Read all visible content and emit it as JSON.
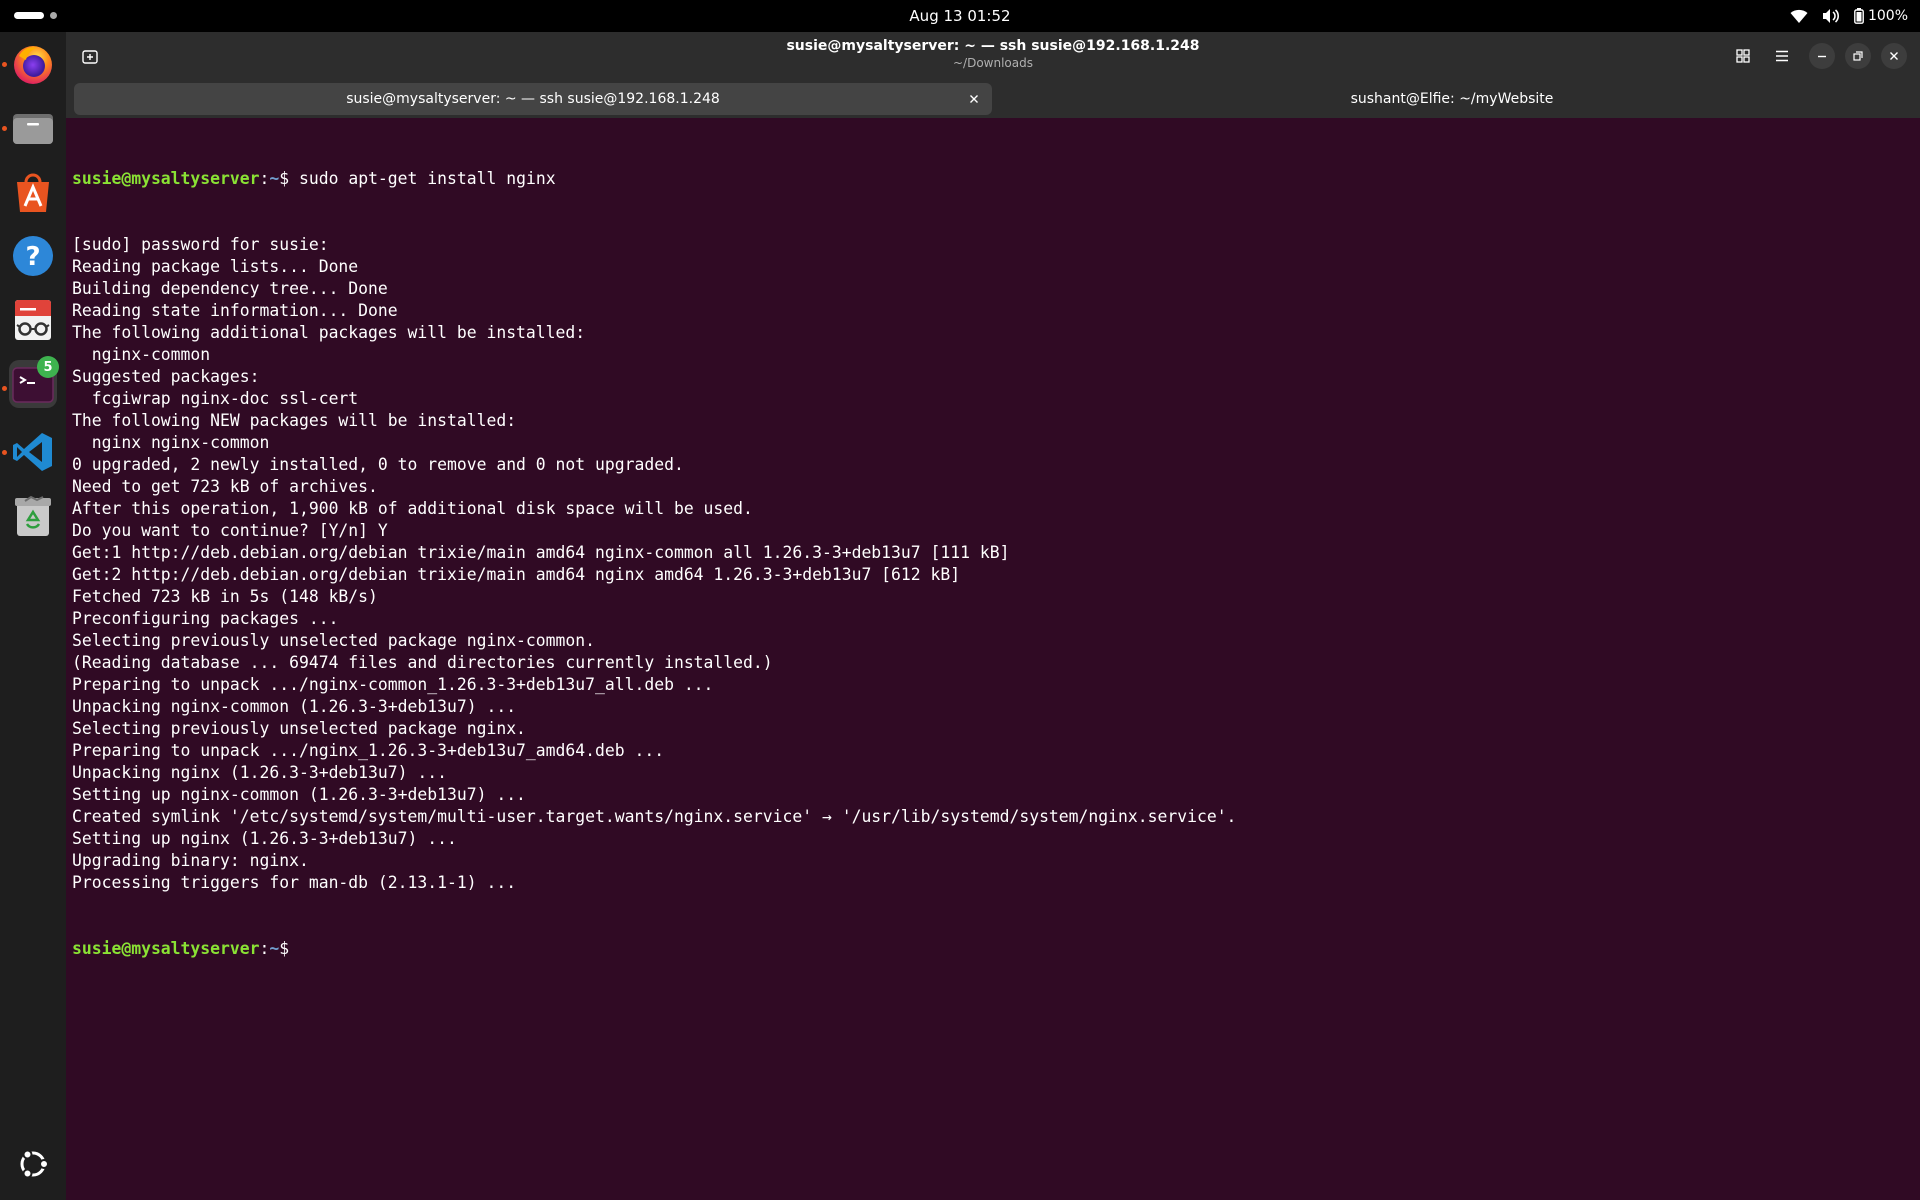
{
  "topbar": {
    "clock": "Aug 13  01:52",
    "battery": "100%"
  },
  "dock": {
    "apps": [
      {
        "name": "firefox",
        "icon": "firefox-icon",
        "running": true
      },
      {
        "name": "files",
        "icon": "files-icon",
        "running": true
      },
      {
        "name": "app-center",
        "icon": "app-center-icon",
        "running": false
      },
      {
        "name": "help",
        "icon": "help-icon",
        "running": false
      },
      {
        "name": "document-viewer",
        "icon": "document-viewer-icon",
        "running": false
      },
      {
        "name": "terminal",
        "icon": "terminal-icon",
        "running": true,
        "badge": "5"
      },
      {
        "name": "vscode",
        "icon": "vscode-icon",
        "running": true
      },
      {
        "name": "trash",
        "icon": "trash-icon",
        "running": false
      },
      {
        "name": "show-apps",
        "icon": "ubuntu-logo-icon",
        "running": false
      }
    ]
  },
  "window": {
    "title": "susie@mysaltyserver: ~ — ssh susie@192.168.1.248",
    "subtitle": "~/Downloads",
    "tabs": [
      {
        "label": "susie@mysaltyserver: ~ — ssh susie@192.168.1.248",
        "active": true
      },
      {
        "label": "sushant@Elfie: ~/myWebsite",
        "active": false
      }
    ]
  },
  "terminal": {
    "prompt_user": "susie@mysaltyserver",
    "prompt_path": "~",
    "prompt_symbol": "$",
    "command": " sudo apt-get install nginx",
    "output": [
      "[sudo] password for susie:",
      "Reading package lists... Done",
      "Building dependency tree... Done",
      "Reading state information... Done",
      "The following additional packages will be installed:",
      "  nginx-common",
      "Suggested packages:",
      "  fcgiwrap nginx-doc ssl-cert",
      "The following NEW packages will be installed:",
      "  nginx nginx-common",
      "0 upgraded, 2 newly installed, 0 to remove and 0 not upgraded.",
      "Need to get 723 kB of archives.",
      "After this operation, 1,900 kB of additional disk space will be used.",
      "Do you want to continue? [Y/n] Y",
      "Get:1 http://deb.debian.org/debian trixie/main amd64 nginx-common all 1.26.3-3+deb13u7 [111 kB]",
      "Get:2 http://deb.debian.org/debian trixie/main amd64 nginx amd64 1.26.3-3+deb13u7 [612 kB]",
      "Fetched 723 kB in 5s (148 kB/s)",
      "Preconfiguring packages ...",
      "Selecting previously unselected package nginx-common.",
      "(Reading database ... 69474 files and directories currently installed.)",
      "Preparing to unpack .../nginx-common_1.26.3-3+deb13u7_all.deb ...",
      "Unpacking nginx-common (1.26.3-3+deb13u7) ...",
      "Selecting previously unselected package nginx.",
      "Preparing to unpack .../nginx_1.26.3-3+deb13u7_amd64.deb ...",
      "Unpacking nginx (1.26.3-3+deb13u7) ...",
      "Setting up nginx-common (1.26.3-3+deb13u7) ...",
      "Created symlink '/etc/systemd/system/multi-user.target.wants/nginx.service' → '/usr/lib/systemd/system/nginx.service'.",
      "Setting up nginx (1.26.3-3+deb13u7) ...",
      "Upgrading binary: nginx.",
      "Processing triggers for man-db (2.13.1-1) ..."
    ]
  }
}
